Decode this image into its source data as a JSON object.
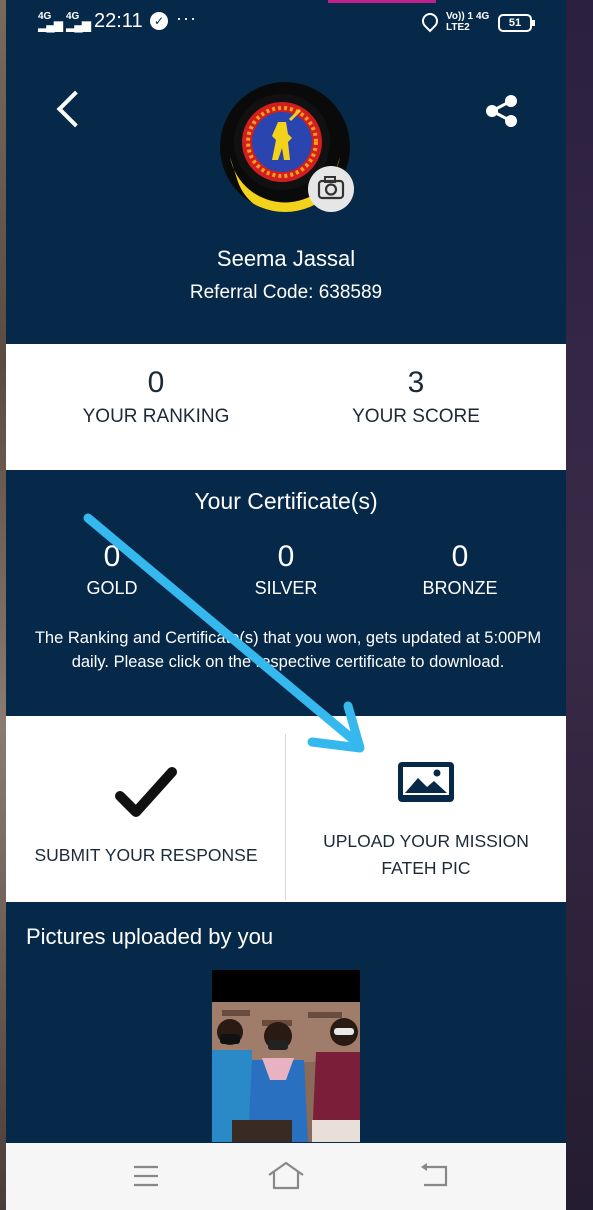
{
  "status_bar": {
    "sim1_type": "4G",
    "sim2_type": "4G",
    "time": "22:11",
    "overflow": "···",
    "volte_line1": "Vo)) 1",
    "volte_line2": "LTE2",
    "net_type": "4G",
    "battery": "51"
  },
  "profile": {
    "name": "Seema Jassal",
    "referral": "Referral Code: 638589",
    "avatar_icon": "college-logo",
    "camera_icon": "camera-icon"
  },
  "stats": [
    {
      "value": "0",
      "label": "YOUR RANKING"
    },
    {
      "value": "3",
      "label": "YOUR SCORE"
    }
  ],
  "certificates": {
    "title": "Your Certificate(s)",
    "items": [
      {
        "value": "0",
        "label": "GOLD"
      },
      {
        "value": "0",
        "label": "SILVER"
      },
      {
        "value": "0",
        "label": "BRONZE"
      }
    ],
    "note": "The Ranking and Certificate(s) that you won, gets updated at 5:00PM daily. Please click on the respective certificate to download."
  },
  "actions": {
    "submit_label": "SUBMIT YOUR RESPONSE",
    "upload_line1": "UPLOAD YOUR MISSION",
    "upload_line2": "FATEH PIC"
  },
  "pictures": {
    "title": "Pictures uploaded by you"
  },
  "colors": {
    "primary": "#06294a",
    "arrow": "#35b8ee",
    "text_dark": "#1c2a38"
  }
}
